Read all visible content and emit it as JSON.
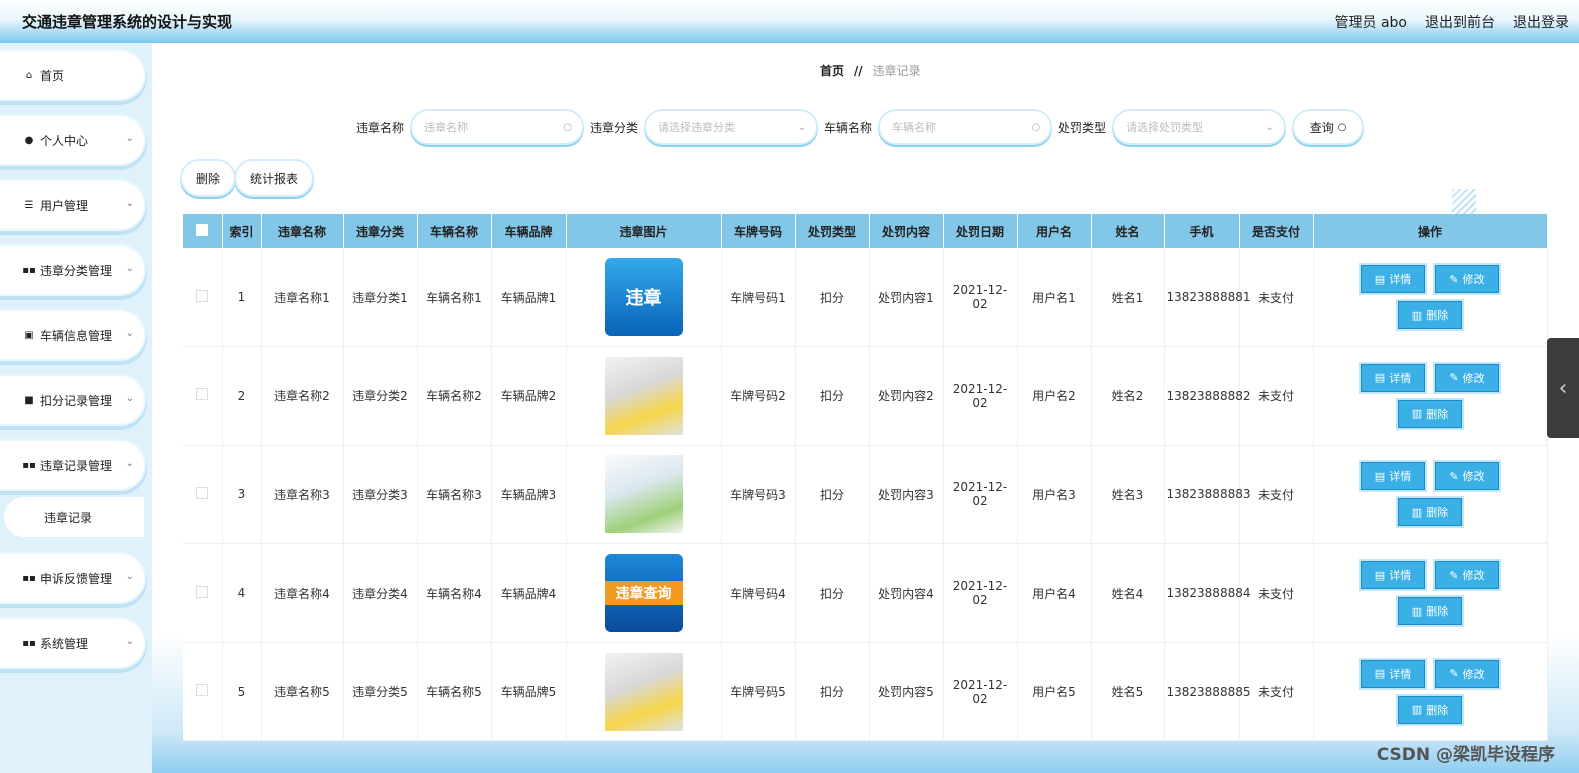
{
  "header": {
    "title": "交通违章管理系统的设计与实现",
    "user_label": "管理员 abo",
    "to_front": "退出到前台",
    "logout": "退出登录"
  },
  "sidebar": {
    "items": [
      {
        "label": "首页",
        "icon": "home-icon"
      },
      {
        "label": "个人中心",
        "icon": "user-icon"
      },
      {
        "label": "用户管理",
        "icon": "sliders-icon"
      },
      {
        "label": "违章分类管理",
        "icon": "grid-icon"
      },
      {
        "label": "车辆信息管理",
        "icon": "car-doc-icon"
      },
      {
        "label": "扣分记录管理",
        "icon": "record-icon"
      },
      {
        "label": "违章记录管理",
        "icon": "grid-icon"
      },
      {
        "label": "申诉反馈管理",
        "icon": "grid-icon"
      },
      {
        "label": "系统管理",
        "icon": "grid-icon"
      }
    ],
    "subitem": "违章记录"
  },
  "breadcrumb": {
    "home": "首页",
    "sep": "//",
    "current": "违章记录"
  },
  "search": {
    "name_label": "违章名称",
    "name_placeholder": "违章名称",
    "cat_label": "违章分类",
    "cat_placeholder": "请选择违章分类",
    "car_label": "车辆名称",
    "car_placeholder": "车辆名称",
    "type_label": "处罚类型",
    "type_placeholder": "请选择处罚类型",
    "query": "查询"
  },
  "toolbar": {
    "delete": "删除",
    "report": "统计报表"
  },
  "table": {
    "headers": [
      "索引",
      "违章名称",
      "违章分类",
      "车辆名称",
      "车辆品牌",
      "违章图片",
      "车牌号码",
      "处罚类型",
      "处罚内容",
      "处罚日期",
      "用户名",
      "姓名",
      "手机",
      "是否支付",
      "操作"
    ],
    "rows": [
      {
        "idx": "1",
        "name": "违章名称1",
        "cat": "违章分类1",
        "car": "车辆名称1",
        "brand": "车辆品牌1",
        "img_text": "违章",
        "plate": "车牌号码1",
        "ptype": "扣分",
        "pcontent": "处罚内容1",
        "date": "2021-12-02",
        "user": "用户名1",
        "real": "姓名1",
        "phone": "13823888881",
        "paid": "未支付"
      },
      {
        "idx": "2",
        "name": "违章名称2",
        "cat": "违章分类2",
        "car": "车辆名称2",
        "brand": "车辆品牌2",
        "img_text": "",
        "plate": "车牌号码2",
        "ptype": "扣分",
        "pcontent": "处罚内容2",
        "date": "2021-12-02",
        "user": "用户名2",
        "real": "姓名2",
        "phone": "13823888882",
        "paid": "未支付"
      },
      {
        "idx": "3",
        "name": "违章名称3",
        "cat": "违章分类3",
        "car": "车辆名称3",
        "brand": "车辆品牌3",
        "img_text": "",
        "plate": "车牌号码3",
        "ptype": "扣分",
        "pcontent": "处罚内容3",
        "date": "2021-12-02",
        "user": "用户名3",
        "real": "姓名3",
        "phone": "13823888883",
        "paid": "未支付"
      },
      {
        "idx": "4",
        "name": "违章名称4",
        "cat": "违章分类4",
        "car": "车辆名称4",
        "brand": "车辆品牌4",
        "img_text": "违章查询",
        "plate": "车牌号码4",
        "ptype": "扣分",
        "pcontent": "处罚内容4",
        "date": "2021-12-02",
        "user": "用户名4",
        "real": "姓名4",
        "phone": "13823888884",
        "paid": "未支付"
      },
      {
        "idx": "5",
        "name": "违章名称5",
        "cat": "违章分类5",
        "car": "车辆名称5",
        "brand": "车辆品牌5",
        "img_text": "",
        "plate": "车牌号码5",
        "ptype": "扣分",
        "pcontent": "处罚内容5",
        "date": "2021-12-02",
        "user": "用户名5",
        "real": "姓名5",
        "phone": "13823888885",
        "paid": "未支付"
      }
    ],
    "ops": {
      "detail": "详情",
      "edit": "修改",
      "delete": "删除"
    }
  },
  "watermark": "CSDN @梁凯毕设程序",
  "colors": {
    "accent": "#83c7e8",
    "button": "#3ab0e6",
    "sidebar_bg": "#dff2fb"
  }
}
